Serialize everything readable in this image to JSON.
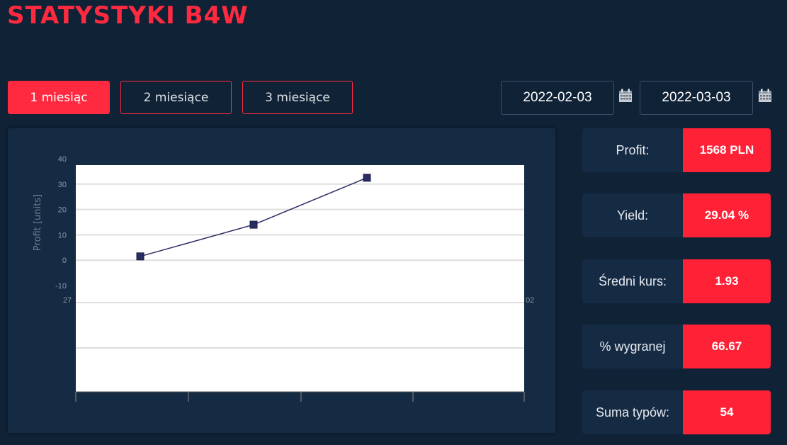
{
  "header": {
    "title": "STATYSTYKI B4W"
  },
  "range_buttons": [
    {
      "label": "1 miesiąc",
      "active": true
    },
    {
      "label": "2 miesiące",
      "active": false
    },
    {
      "label": "3 miesiące",
      "active": false
    }
  ],
  "dates": {
    "from": "2022-02-03",
    "to": "2022-03-03",
    "icon": "calendar-icon"
  },
  "chart_data": {
    "type": "line",
    "ylabel": "Profit [units]",
    "ylim": [
      -10,
      40
    ],
    "y_ticks": [
      "40",
      "30",
      "20",
      "10",
      "0",
      "-10"
    ],
    "x_tick_fragments": [
      "27",
      "02"
    ],
    "grid": true,
    "line_color": "#2b2c62",
    "points": [
      {
        "x": 1,
        "y": 1.5
      },
      {
        "x": 2,
        "y": 14
      },
      {
        "x": 3,
        "y": 32.5
      }
    ]
  },
  "stats": [
    {
      "label": "Profit:",
      "value": "1568 PLN"
    },
    {
      "label": "Yield:",
      "value": "29.04 %"
    },
    {
      "label": "Średni kurs:",
      "value": "1.93"
    },
    {
      "label": "% wygranej",
      "value": "66.67"
    },
    {
      "label": "Suma typów:",
      "value": "54"
    }
  ],
  "colors": {
    "background": "#0f2236",
    "panel": "#152a43",
    "accent": "#ff2a3f"
  }
}
